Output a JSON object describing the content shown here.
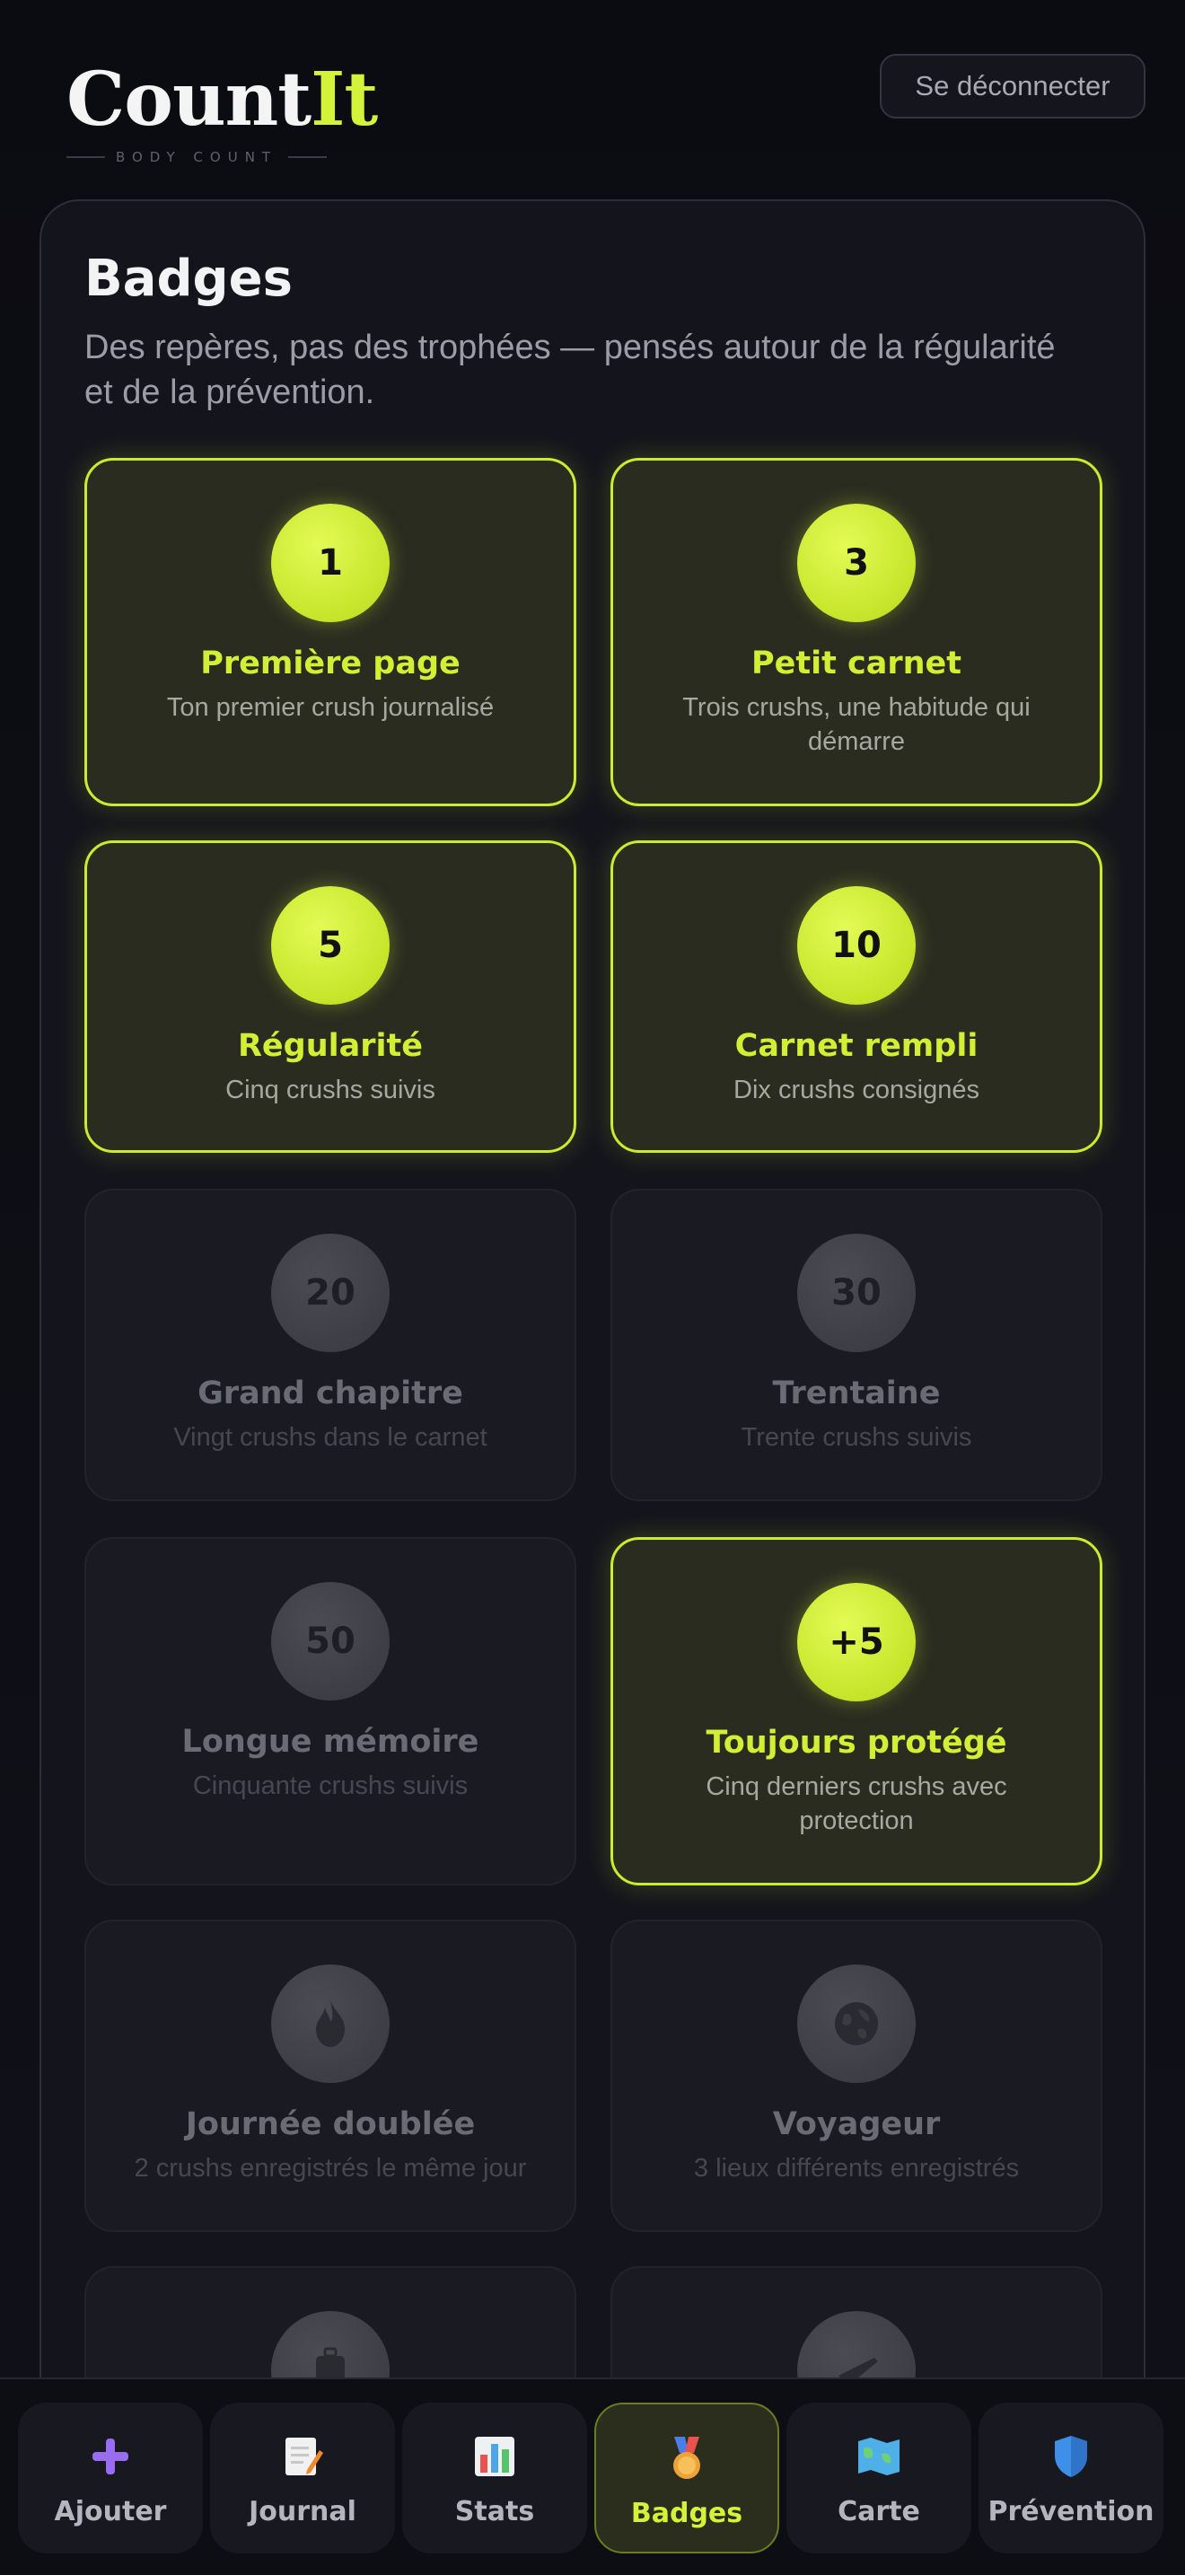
{
  "header": {
    "logo_main": "Count",
    "logo_accent": "It",
    "logo_sub": "BODY COUNT",
    "logout_label": "Se déconnecter"
  },
  "panel": {
    "title": "Badges",
    "description": "Des repères, pas des trophées — pensés autour de la régularité et de la prévention."
  },
  "badges": [
    {
      "medal": "1",
      "name": "Première page",
      "desc": "Ton premier crush journalisé",
      "unlocked": true
    },
    {
      "medal": "3",
      "name": "Petit carnet",
      "desc": "Trois crushs, une habitude qui démarre",
      "unlocked": true
    },
    {
      "medal": "5",
      "name": "Régularité",
      "desc": "Cinq crushs suivis",
      "unlocked": true
    },
    {
      "medal": "10",
      "name": "Carnet rempli",
      "desc": "Dix crushs consignés",
      "unlocked": true
    },
    {
      "medal": "20",
      "name": "Grand chapitre",
      "desc": "Vingt crushs dans le carnet",
      "unlocked": false
    },
    {
      "medal": "30",
      "name": "Trentaine",
      "desc": "Trente crushs suivis",
      "unlocked": false
    },
    {
      "medal": "50",
      "name": "Longue mémoire",
      "desc": "Cinquante crushs suivis",
      "unlocked": false
    },
    {
      "medal": "+5",
      "name": "Toujours protégé",
      "desc": "Cinq derniers crushs avec protection",
      "unlocked": true
    },
    {
      "medal": "",
      "icon": "flame-icon",
      "name": "Journée doublée",
      "desc": "2 crushs enregistrés le même jour",
      "unlocked": false
    },
    {
      "medal": "",
      "icon": "globe-icon",
      "name": "Voyageur",
      "desc": "3 lieux différents enregistrés",
      "unlocked": false
    },
    {
      "medal": "",
      "icon": "luggage-icon",
      "name": "",
      "desc": "",
      "unlocked": false
    },
    {
      "medal": "",
      "icon": "airplane-icon",
      "name": "",
      "desc": "",
      "unlocked": false
    }
  ],
  "nav": [
    {
      "label": "Ajouter",
      "icon": "plus-icon",
      "active": false
    },
    {
      "label": "Journal",
      "icon": "memo-icon",
      "active": false
    },
    {
      "label": "Stats",
      "icon": "bar-chart-icon",
      "active": false
    },
    {
      "label": "Badges",
      "icon": "medal-icon",
      "active": true
    },
    {
      "label": "Carte",
      "icon": "map-icon",
      "active": false
    },
    {
      "label": "Prévention",
      "icon": "shield-icon",
      "active": false
    }
  ],
  "colors": {
    "accent": "#d4f23a",
    "background": "#0c0d12",
    "panel": "#14151c",
    "unlocked_card": "#2a2c20",
    "locked_card": "#1a1b22"
  }
}
